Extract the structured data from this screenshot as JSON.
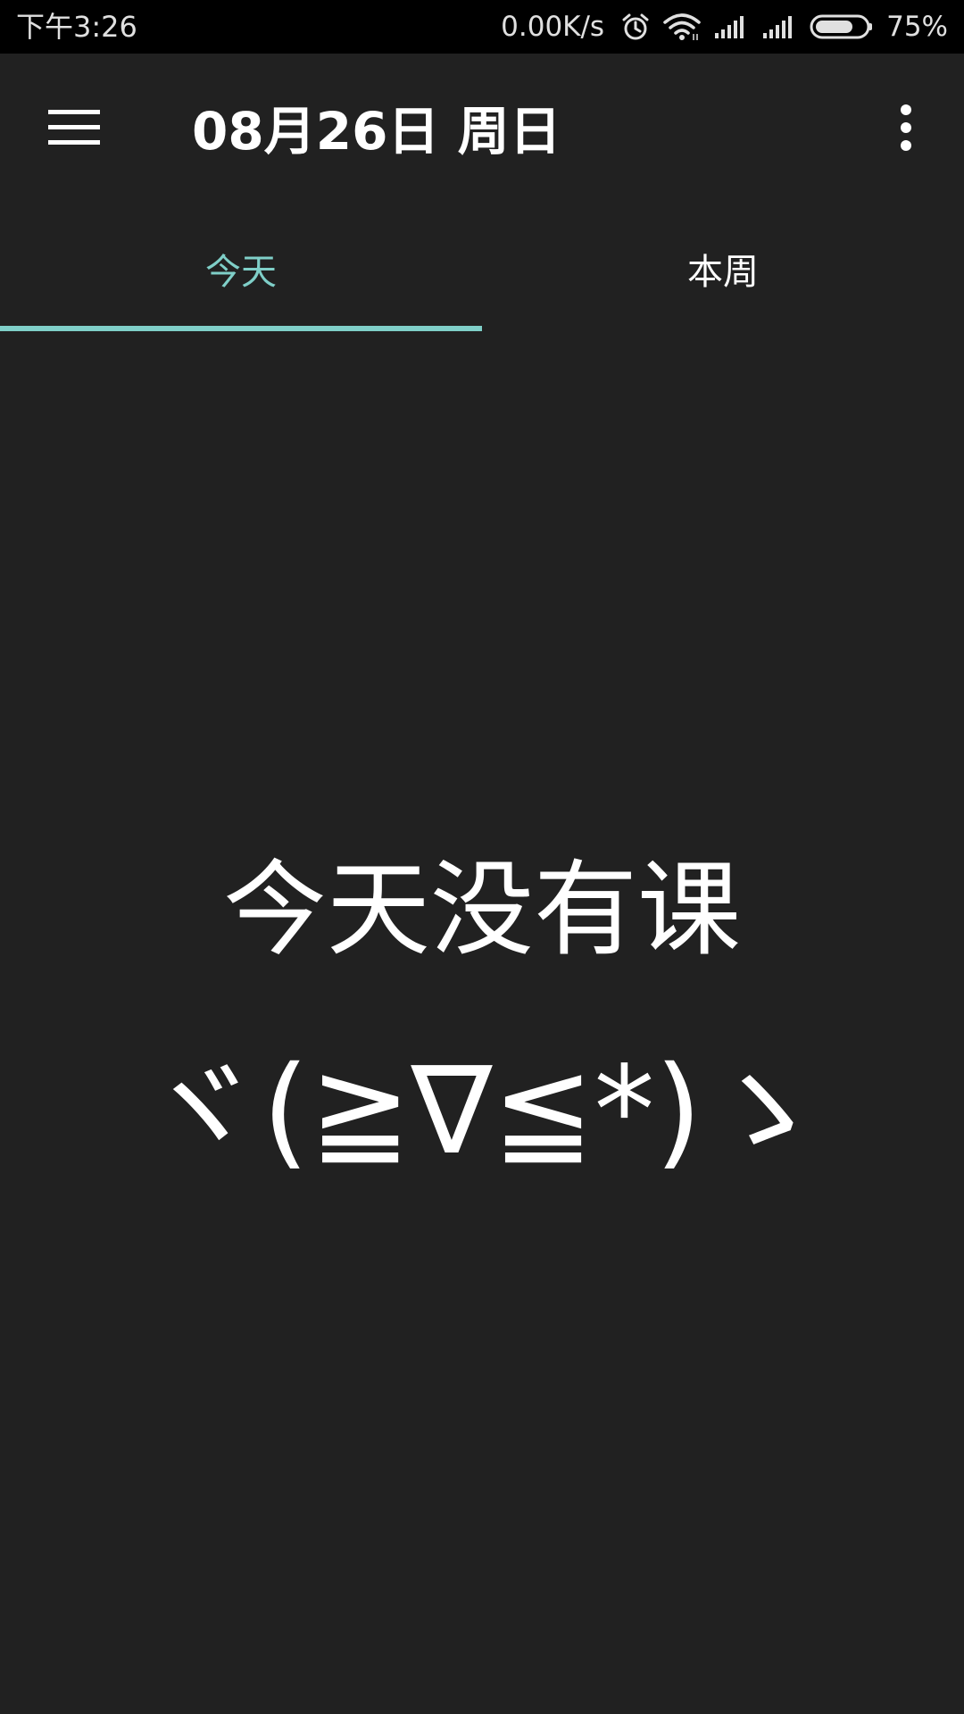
{
  "status_bar": {
    "time": "下午3:26",
    "net_speed": "0.00K/s",
    "battery_percent": "75%",
    "battery_level": 0.75,
    "icons": [
      "alarm-icon",
      "wifi-icon",
      "signal-icon",
      "signal-icon",
      "battery-icon"
    ]
  },
  "app_bar": {
    "title": "08月26日 周日",
    "menu_icon": "hamburger-menu-icon",
    "more_icon": "more-vertical-icon"
  },
  "tabs": [
    {
      "label": "今天",
      "active": true
    },
    {
      "label": "本周",
      "active": false
    }
  ],
  "empty_state": {
    "message": "今天没有课",
    "emoticon": "ヾ(≧∇≦*)ゝ"
  },
  "colors": {
    "background": "#212121",
    "status_bar": "#000000",
    "accent": "#7fcfc8",
    "text": "#ffffff"
  }
}
